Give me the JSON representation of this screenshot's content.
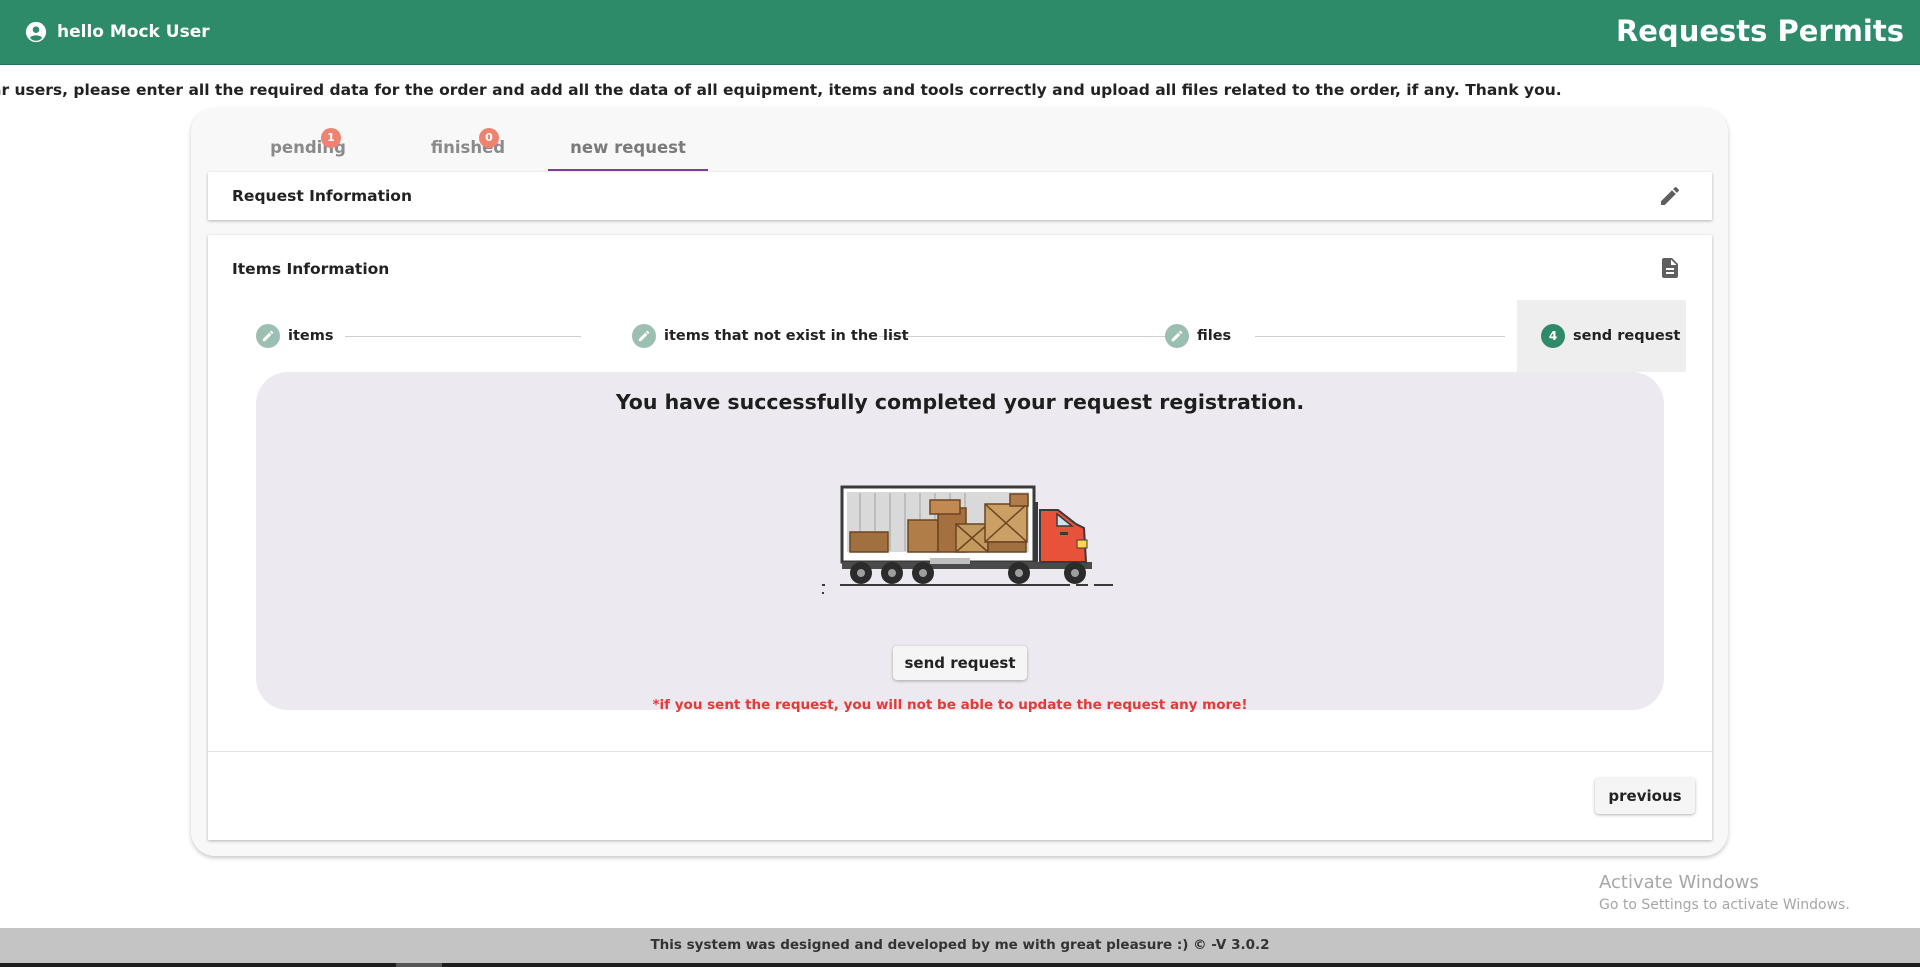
{
  "header": {
    "greeting": "hello Mock User",
    "app_title": "Requests Permits",
    "user_icon": "account-circle-icon"
  },
  "notice": "ar users, please enter all the required data for the order and add all the data of all equipment, items and tools correctly and upload all files related to the order, if any. Thank you.",
  "tabs": [
    {
      "label": "pending",
      "badge": "1"
    },
    {
      "label": "finished",
      "badge": "0"
    },
    {
      "label": "new request",
      "active": true
    }
  ],
  "request_panel": {
    "title": "Request Information",
    "icon": "pencil-icon"
  },
  "items_panel": {
    "title": "Items Information",
    "icon": "document-icon",
    "steps": [
      {
        "label": "items",
        "state": "completed"
      },
      {
        "label": "items that not exist in the list",
        "state": "completed"
      },
      {
        "label": "files",
        "state": "completed"
      },
      {
        "label": "send request",
        "number": "4",
        "state": "active"
      }
    ],
    "success_message": "You have successfully completed your request registration.",
    "illustration": "delivery-truck-illustration",
    "send_button": "send request",
    "warning": "*if you sent the request, you will not be able to update the request any more!",
    "previous_button": "previous"
  },
  "watermark": {
    "line1": "Activate Windows",
    "line2": "Go to Settings to activate Windows."
  },
  "footer": "This system was designed and developed by me with great pleasure :) © -V 3.0.2",
  "colors": {
    "primary": "#2e8b6a",
    "tab_underline": "#7b3fa0",
    "badge": "#ef8270",
    "warning": "#e53935"
  }
}
